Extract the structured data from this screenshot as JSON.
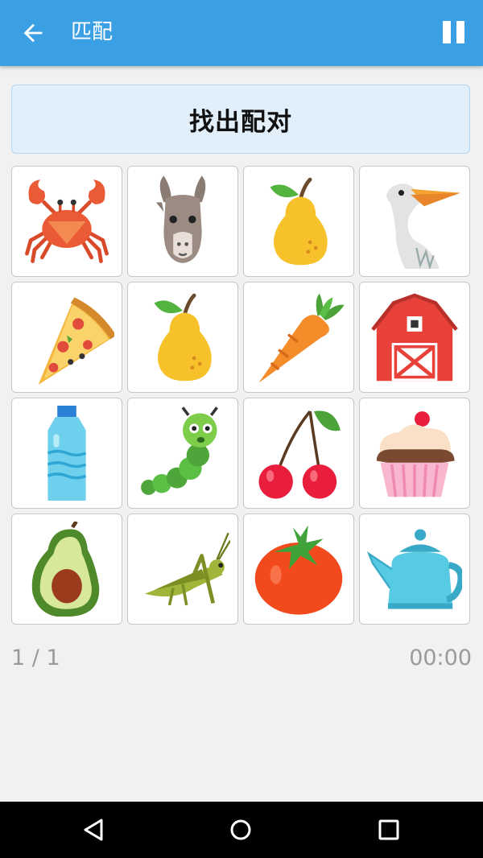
{
  "app_bar": {
    "title": "匹配"
  },
  "instruction": "找出配对",
  "cards": [
    {
      "icon": "crab-icon"
    },
    {
      "icon": "llama-icon"
    },
    {
      "icon": "pear-icon"
    },
    {
      "icon": "pelican-icon"
    },
    {
      "icon": "pizza-slice-icon"
    },
    {
      "icon": "pear-icon"
    },
    {
      "icon": "carrot-icon"
    },
    {
      "icon": "barn-icon"
    },
    {
      "icon": "water-bottle-icon"
    },
    {
      "icon": "caterpillar-icon"
    },
    {
      "icon": "cherries-icon"
    },
    {
      "icon": "cupcake-icon"
    },
    {
      "icon": "avocado-icon"
    },
    {
      "icon": "grasshopper-icon"
    },
    {
      "icon": "tomato-icon"
    },
    {
      "icon": "teapot-icon"
    }
  ],
  "status": {
    "progress": "1 / 1",
    "timer": "00:00"
  },
  "colors": {
    "app_bar": "#3a9fe3",
    "banner_bg": "#e1effb",
    "banner_border": "#b7d7f1"
  }
}
